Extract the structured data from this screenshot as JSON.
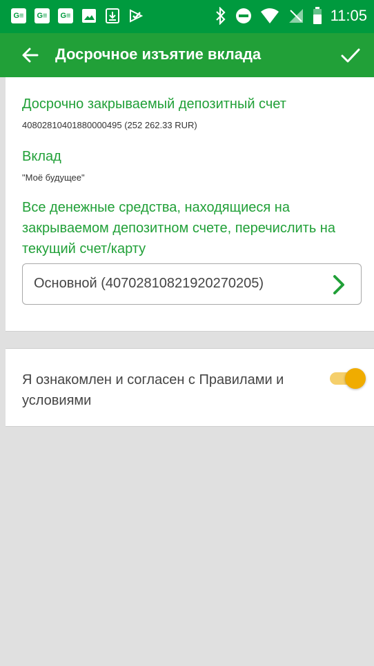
{
  "status_bar": {
    "icons_left": [
      "G≡",
      "G≡",
      "G≡",
      "image-icon",
      "download-icon",
      "check-alert-icon"
    ],
    "icons_right": [
      "bluetooth-icon",
      "do-not-disturb-icon",
      "wifi-icon",
      "no-sim-icon",
      "battery-icon"
    ],
    "time": "11:05"
  },
  "app_bar": {
    "title": "Досрочное изъятие вклада"
  },
  "form": {
    "account_label": "Досрочно закрываемый депозитный счет",
    "account_value": "40802810401880000495 (252 262.33 RUR)",
    "deposit_label": "Вклад",
    "deposit_value": "\"Моё будущее\"",
    "transfer_label": "Все денежные средства, находящиеся на закрываемом депозитном счете, перечислить на текущий счет/карту",
    "transfer_value": "Основной (40702810821920270205)"
  },
  "agreement": {
    "text": "Я ознакомлен и согласен с Правилами и условиями",
    "toggle_on": true
  },
  "colors": {
    "status_bar": "#009a3e",
    "app_bar": "#21a038",
    "accent_green": "#21a038",
    "toggle_thumb": "#f0ac00",
    "toggle_track": "#f5cf6b"
  }
}
